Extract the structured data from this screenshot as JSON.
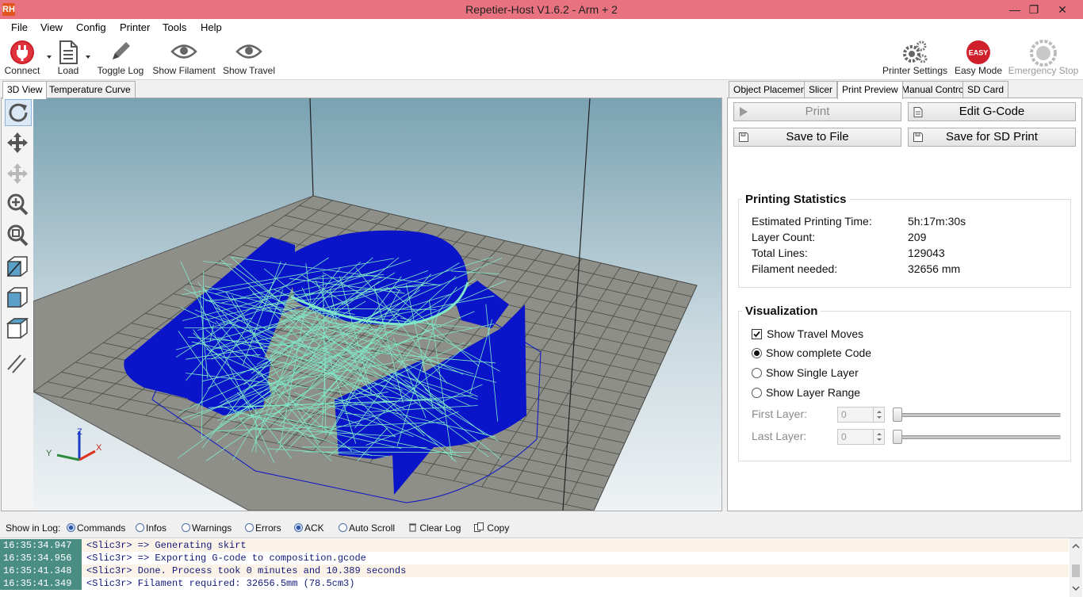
{
  "window": {
    "title": "Repetier-Host V1.6.2 - Arm + 2",
    "app_icon": "RH",
    "minimize": "—",
    "restore": "❐",
    "close": "✕"
  },
  "menu": [
    "File",
    "View",
    "Config",
    "Printer",
    "Tools",
    "Help"
  ],
  "toolbar": {
    "connect": "Connect",
    "load": "Load",
    "toggle_log": "Toggle Log",
    "show_filament": "Show Filament",
    "show_travel": "Show Travel",
    "printer_settings": "Printer Settings",
    "easy_mode": "Easy Mode",
    "easy_badge": "EASY",
    "emergency_stop": "Emergency Stop"
  },
  "left_tabs": [
    "3D View",
    "Temperature Curve"
  ],
  "right_tabs": [
    "Object Placement",
    "Slicer",
    "Print Preview",
    "Manual Control",
    "SD Card"
  ],
  "preview": {
    "print": "Print",
    "edit_gcode": "Edit G-Code",
    "save_to_file": "Save to File",
    "save_for_sd": "Save for SD Print"
  },
  "stats": {
    "title": "Printing Statistics",
    "rows": [
      {
        "label": "Estimated Printing Time:",
        "value": "5h:17m:30s"
      },
      {
        "label": "Layer Count:",
        "value": "209"
      },
      {
        "label": "Total Lines:",
        "value": "129043"
      },
      {
        "label": "Filament needed:",
        "value": "32656 mm"
      }
    ]
  },
  "visualization": {
    "title": "Visualization",
    "show_travel_moves": "Show Travel Moves",
    "show_complete_code": "Show complete Code",
    "show_single_layer": "Show Single Layer",
    "show_layer_range": "Show Layer Range",
    "first_layer_label": "First Layer:",
    "last_layer_label": "Last Layer:",
    "first_layer_value": "0",
    "last_layer_value": "0"
  },
  "axes": {
    "x": "X",
    "y": "Y",
    "z": "Z"
  },
  "logbar": {
    "show_in_log": "Show in Log:",
    "commands": "Commands",
    "infos": "Infos",
    "warnings": "Warnings",
    "errors": "Errors",
    "ack": "ACK",
    "auto_scroll": "Auto Scroll",
    "clear_log": "Clear Log",
    "copy": "Copy"
  },
  "log": [
    {
      "time": "16:35:34.947",
      "msg": "<Slic3r> => Generating skirt"
    },
    {
      "time": "16:35:34.956",
      "msg": "<Slic3r> => Exporting G-code to composition.gcode"
    },
    {
      "time": "16:35:41.348",
      "msg": "<Slic3r> Done. Process took 0 minutes and 10.389 seconds"
    },
    {
      "time": "16:35:41.349",
      "msg": "<Slic3r> Filament required: 32656.5mm (78.5cm3)"
    }
  ],
  "colors": {
    "titlebar": "#e8727f",
    "extrusion": "#0a14c8",
    "travel": "#7fe8c8",
    "log_timestamp": "#4a8e83"
  }
}
